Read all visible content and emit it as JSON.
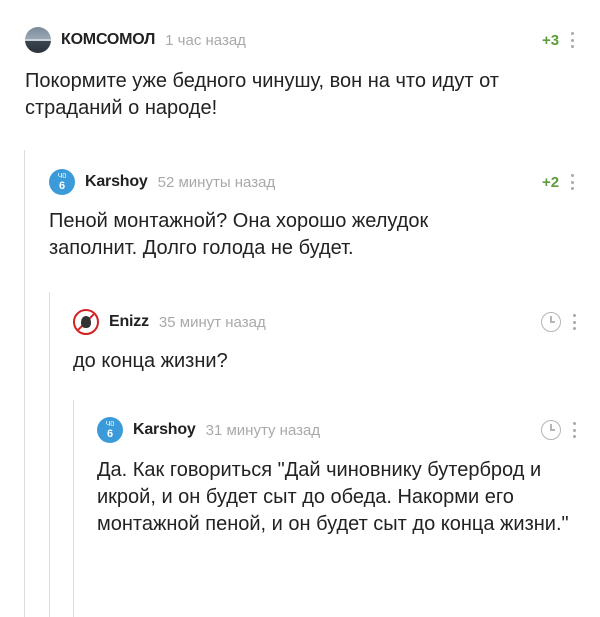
{
  "comments": [
    {
      "author": "КОМСОМОЛ",
      "time": "1 час назад",
      "rating": "+3",
      "avatar": "seascape-avatar",
      "text": "Покормите уже бедного чинушу, вон на что идут от страданий о народе!"
    },
    {
      "author": "Karshoy",
      "time": "52 минуты назад",
      "rating": "+2",
      "avatar": "blue-badge-avatar",
      "avatar_text": [
        "Ч0",
        "6"
      ],
      "text": "Пеной монтажной? Она хорошо желудок заполнит. Долго голода не будет."
    },
    {
      "author": "Enizz",
      "time": "35 минут назад",
      "avatar": "forbidden-sign-avatar",
      "text": "до конца жизни?"
    },
    {
      "author": "Karshoy",
      "time": "31 минуту назад",
      "avatar": "blue-badge-avatar",
      "avatar_text": [
        "Ч0",
        "6"
      ],
      "text": "Да. Как говориться \"Дай чиновнику бутерброд и икрой, и он будет сыт до обеда. Накорми его монтажной пеной, и он будет сыт до конца жизни.\""
    }
  ],
  "icons": {
    "clock": "clock-icon",
    "more": "more-vertical-icon"
  },
  "colors": {
    "rating": "#5c9d3b",
    "time": "#a9a9a9",
    "thread_line": "#dcdcdc",
    "avatar_blue": "#3b9ad9"
  }
}
